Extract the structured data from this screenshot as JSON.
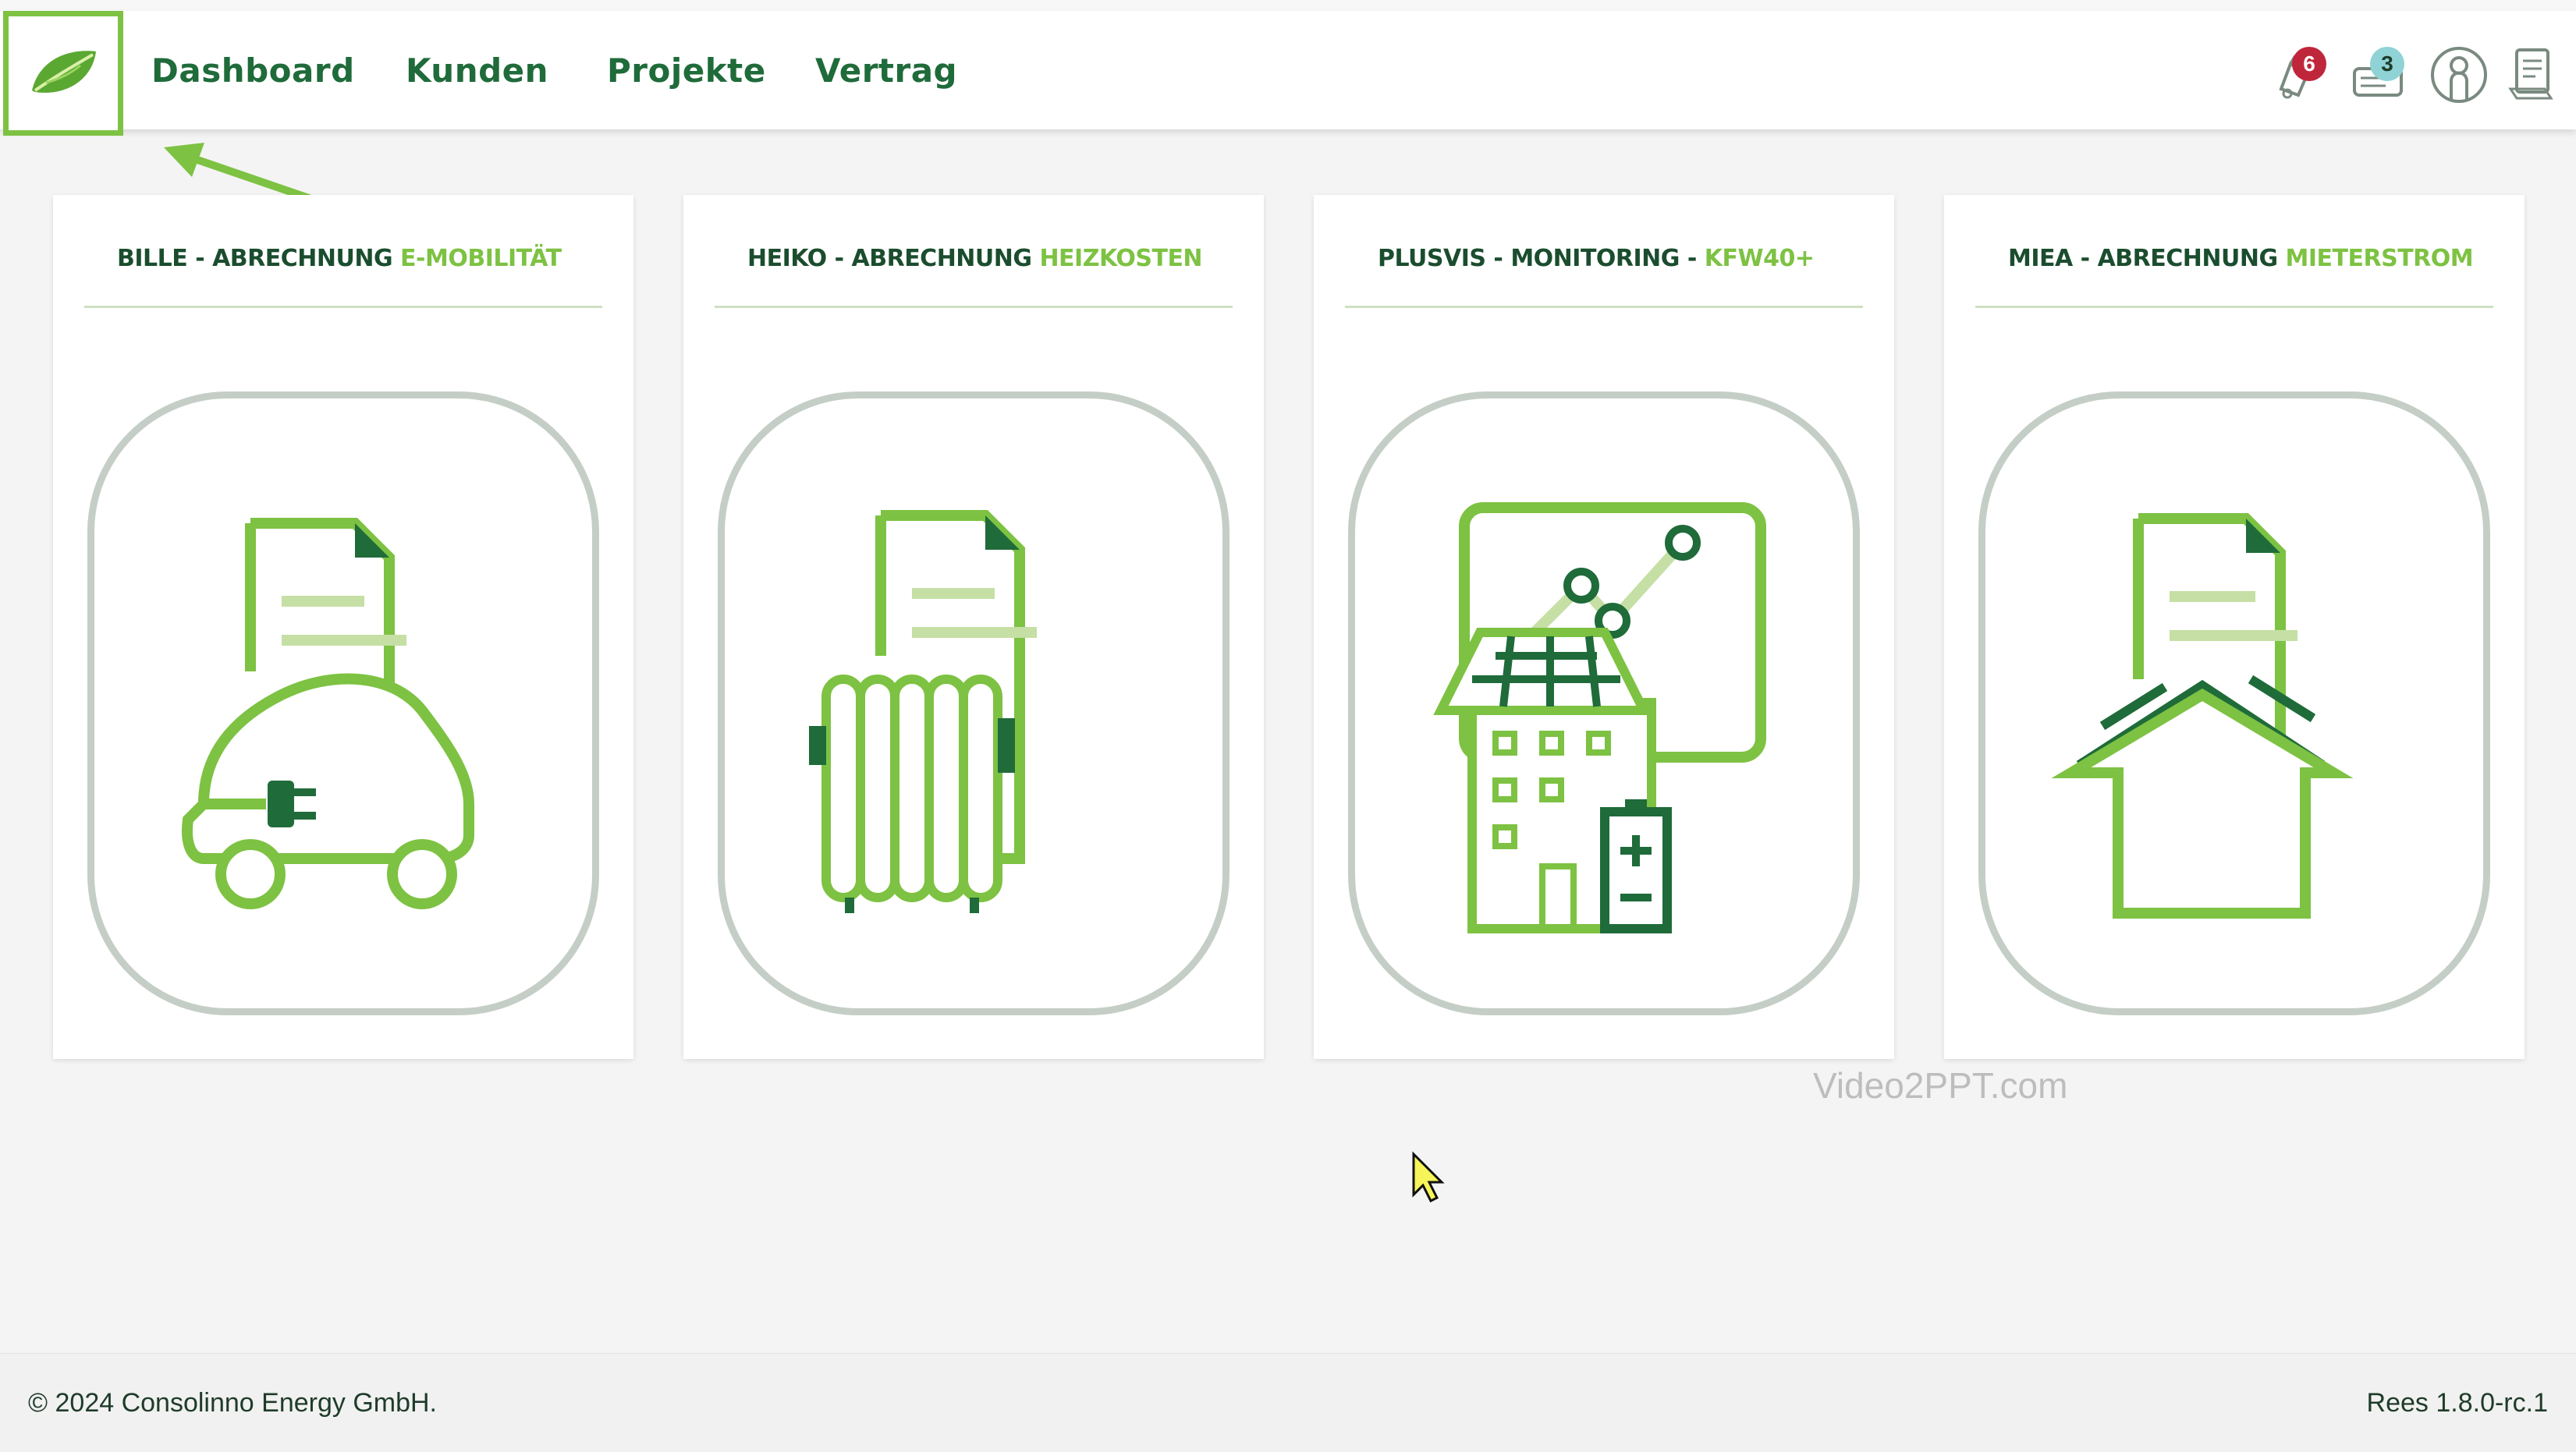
{
  "nav": {
    "items": [
      {
        "label": "Dashboard"
      },
      {
        "label": "Kunden"
      },
      {
        "label": "Projekte"
      },
      {
        "label": "Vertrag"
      }
    ],
    "notifications_count": "6",
    "messages_count": "3",
    "icons": [
      "leaf-logo-icon",
      "bell-icon",
      "ticket-icon",
      "user-icon",
      "document-icon"
    ]
  },
  "cards": [
    {
      "title_main": "BILLE - ABRECHNUNG ",
      "title_accent": "E-MOBILITÄT",
      "icon": "ev-charging-invoice-icon"
    },
    {
      "title_main": "HEIKO - ABRECHNUNG ",
      "title_accent": "HEIZKOSTEN",
      "icon": "radiator-invoice-icon"
    },
    {
      "title_main": "PLUSVIS - MONITORING - ",
      "title_accent": "KFW40+",
      "icon": "solar-house-monitoring-icon"
    },
    {
      "title_main": "MIEA - ABRECHNUNG ",
      "title_accent": "MIETERSTROM",
      "icon": "house-invoice-icon"
    }
  ],
  "watermark": "Video2PPT.com",
  "footer": {
    "copyright": "© 2024 Consolinno Energy GmbH.",
    "version": "Rees 1.8.0-rc.1"
  },
  "colors": {
    "brand_dark": "#1f6b3a",
    "brand_green": "#7dc242",
    "badge_red": "#c0263b",
    "badge_teal": "#8fd3d6"
  }
}
